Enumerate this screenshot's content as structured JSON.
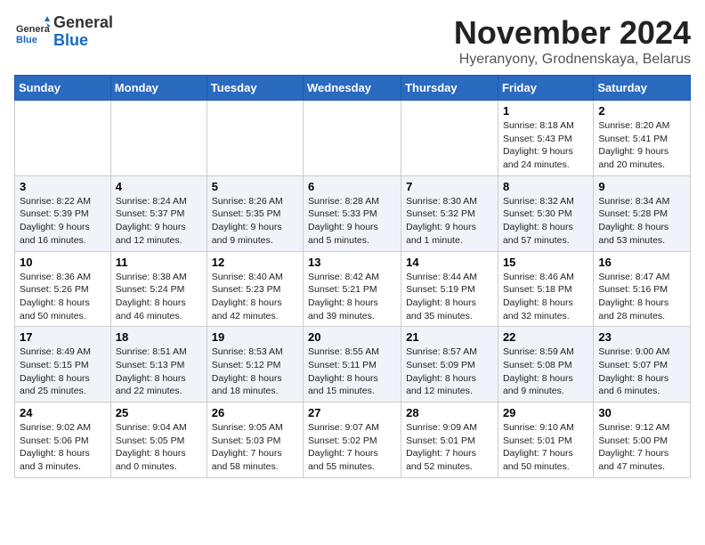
{
  "header": {
    "logo_general": "General",
    "logo_blue": "Blue",
    "month_title": "November 2024",
    "location": "Hyeranyony, Grodnenskaya, Belarus"
  },
  "weekdays": [
    "Sunday",
    "Monday",
    "Tuesday",
    "Wednesday",
    "Thursday",
    "Friday",
    "Saturday"
  ],
  "weeks": [
    [
      {
        "day": "",
        "info": ""
      },
      {
        "day": "",
        "info": ""
      },
      {
        "day": "",
        "info": ""
      },
      {
        "day": "",
        "info": ""
      },
      {
        "day": "",
        "info": ""
      },
      {
        "day": "1",
        "info": "Sunrise: 8:18 AM\nSunset: 5:43 PM\nDaylight: 9 hours\nand 24 minutes."
      },
      {
        "day": "2",
        "info": "Sunrise: 8:20 AM\nSunset: 5:41 PM\nDaylight: 9 hours\nand 20 minutes."
      }
    ],
    [
      {
        "day": "3",
        "info": "Sunrise: 8:22 AM\nSunset: 5:39 PM\nDaylight: 9 hours\nand 16 minutes."
      },
      {
        "day": "4",
        "info": "Sunrise: 8:24 AM\nSunset: 5:37 PM\nDaylight: 9 hours\nand 12 minutes."
      },
      {
        "day": "5",
        "info": "Sunrise: 8:26 AM\nSunset: 5:35 PM\nDaylight: 9 hours\nand 9 minutes."
      },
      {
        "day": "6",
        "info": "Sunrise: 8:28 AM\nSunset: 5:33 PM\nDaylight: 9 hours\nand 5 minutes."
      },
      {
        "day": "7",
        "info": "Sunrise: 8:30 AM\nSunset: 5:32 PM\nDaylight: 9 hours\nand 1 minute."
      },
      {
        "day": "8",
        "info": "Sunrise: 8:32 AM\nSunset: 5:30 PM\nDaylight: 8 hours\nand 57 minutes."
      },
      {
        "day": "9",
        "info": "Sunrise: 8:34 AM\nSunset: 5:28 PM\nDaylight: 8 hours\nand 53 minutes."
      }
    ],
    [
      {
        "day": "10",
        "info": "Sunrise: 8:36 AM\nSunset: 5:26 PM\nDaylight: 8 hours\nand 50 minutes."
      },
      {
        "day": "11",
        "info": "Sunrise: 8:38 AM\nSunset: 5:24 PM\nDaylight: 8 hours\nand 46 minutes."
      },
      {
        "day": "12",
        "info": "Sunrise: 8:40 AM\nSunset: 5:23 PM\nDaylight: 8 hours\nand 42 minutes."
      },
      {
        "day": "13",
        "info": "Sunrise: 8:42 AM\nSunset: 5:21 PM\nDaylight: 8 hours\nand 39 minutes."
      },
      {
        "day": "14",
        "info": "Sunrise: 8:44 AM\nSunset: 5:19 PM\nDaylight: 8 hours\nand 35 minutes."
      },
      {
        "day": "15",
        "info": "Sunrise: 8:46 AM\nSunset: 5:18 PM\nDaylight: 8 hours\nand 32 minutes."
      },
      {
        "day": "16",
        "info": "Sunrise: 8:47 AM\nSunset: 5:16 PM\nDaylight: 8 hours\nand 28 minutes."
      }
    ],
    [
      {
        "day": "17",
        "info": "Sunrise: 8:49 AM\nSunset: 5:15 PM\nDaylight: 8 hours\nand 25 minutes."
      },
      {
        "day": "18",
        "info": "Sunrise: 8:51 AM\nSunset: 5:13 PM\nDaylight: 8 hours\nand 22 minutes."
      },
      {
        "day": "19",
        "info": "Sunrise: 8:53 AM\nSunset: 5:12 PM\nDaylight: 8 hours\nand 18 minutes."
      },
      {
        "day": "20",
        "info": "Sunrise: 8:55 AM\nSunset: 5:11 PM\nDaylight: 8 hours\nand 15 minutes."
      },
      {
        "day": "21",
        "info": "Sunrise: 8:57 AM\nSunset: 5:09 PM\nDaylight: 8 hours\nand 12 minutes."
      },
      {
        "day": "22",
        "info": "Sunrise: 8:59 AM\nSunset: 5:08 PM\nDaylight: 8 hours\nand 9 minutes."
      },
      {
        "day": "23",
        "info": "Sunrise: 9:00 AM\nSunset: 5:07 PM\nDaylight: 8 hours\nand 6 minutes."
      }
    ],
    [
      {
        "day": "24",
        "info": "Sunrise: 9:02 AM\nSunset: 5:06 PM\nDaylight: 8 hours\nand 3 minutes."
      },
      {
        "day": "25",
        "info": "Sunrise: 9:04 AM\nSunset: 5:05 PM\nDaylight: 8 hours\nand 0 minutes."
      },
      {
        "day": "26",
        "info": "Sunrise: 9:05 AM\nSunset: 5:03 PM\nDaylight: 7 hours\nand 58 minutes."
      },
      {
        "day": "27",
        "info": "Sunrise: 9:07 AM\nSunset: 5:02 PM\nDaylight: 7 hours\nand 55 minutes."
      },
      {
        "day": "28",
        "info": "Sunrise: 9:09 AM\nSunset: 5:01 PM\nDaylight: 7 hours\nand 52 minutes."
      },
      {
        "day": "29",
        "info": "Sunrise: 9:10 AM\nSunset: 5:01 PM\nDaylight: 7 hours\nand 50 minutes."
      },
      {
        "day": "30",
        "info": "Sunrise: 9:12 AM\nSunset: 5:00 PM\nDaylight: 7 hours\nand 47 minutes."
      }
    ]
  ]
}
